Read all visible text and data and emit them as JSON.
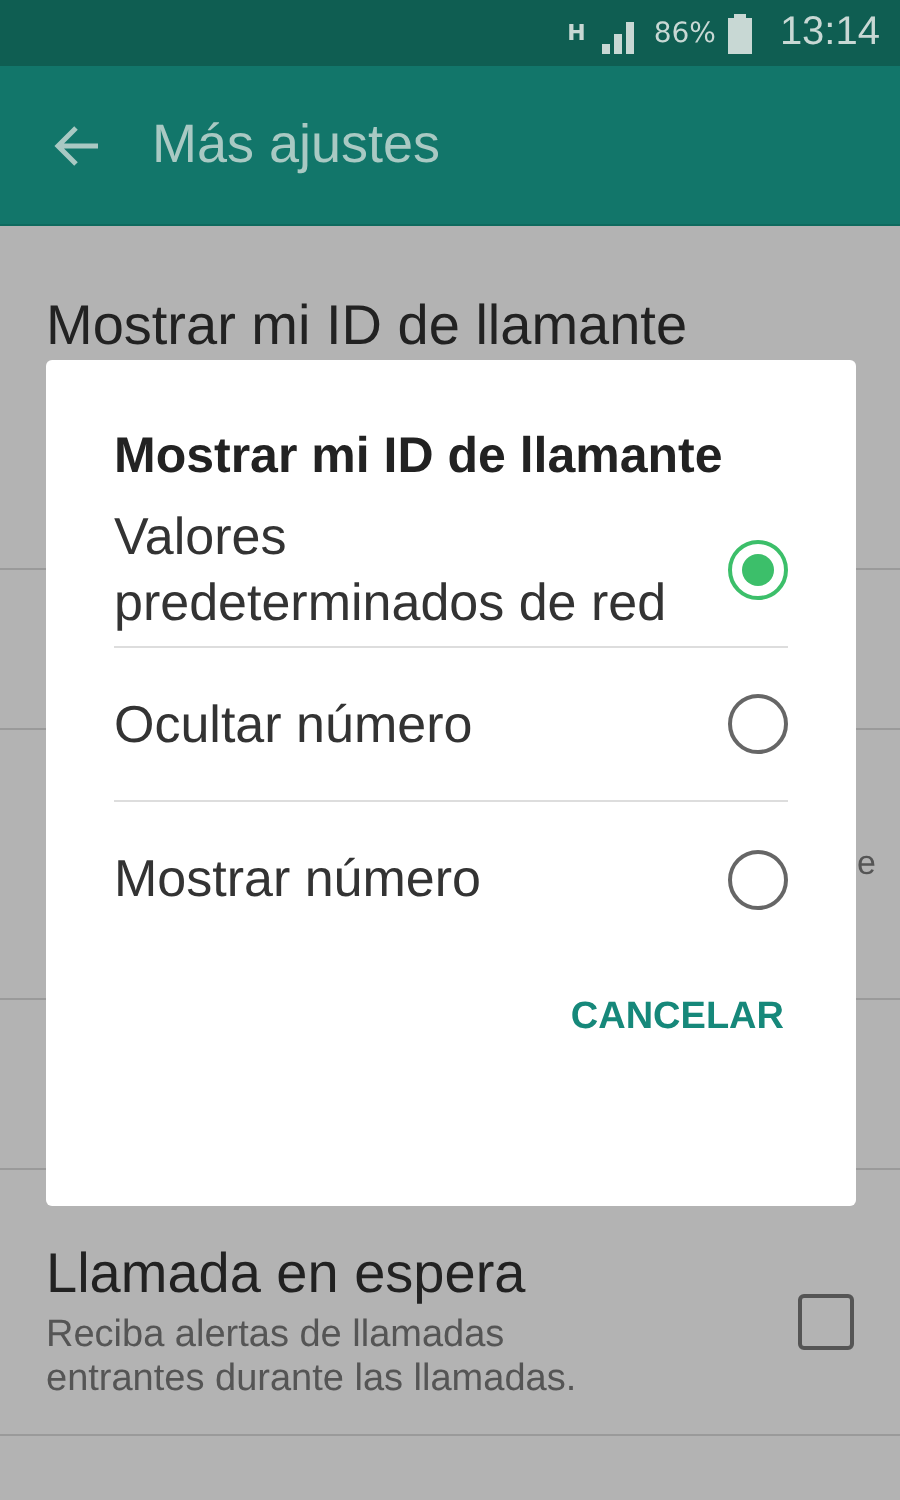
{
  "status_bar": {
    "network": "H",
    "battery": "86%",
    "time": "13:14"
  },
  "app_bar": {
    "title": "Más ajustes"
  },
  "settings": [
    {
      "kind": "title",
      "title": "Mostrar mi ID de llamante"
    },
    {
      "kind": "empty"
    },
    {
      "kind": "fragment",
      "text": "e"
    },
    {
      "kind": "empty"
    },
    {
      "kind": "checkbox",
      "title": "Llamada en espera",
      "subtitle": "Reciba alertas de llamadas entrantes durante las llamadas.",
      "checked": false
    },
    {
      "kind": "empty"
    }
  ],
  "dialog": {
    "title": "Mostrar mi ID de llamante",
    "options": [
      {
        "label": "Valores predeterminados de red",
        "selected": true
      },
      {
        "label": "Ocultar número",
        "selected": false
      },
      {
        "label": "Mostrar número",
        "selected": false
      }
    ],
    "cancel": "CANCELAR"
  }
}
